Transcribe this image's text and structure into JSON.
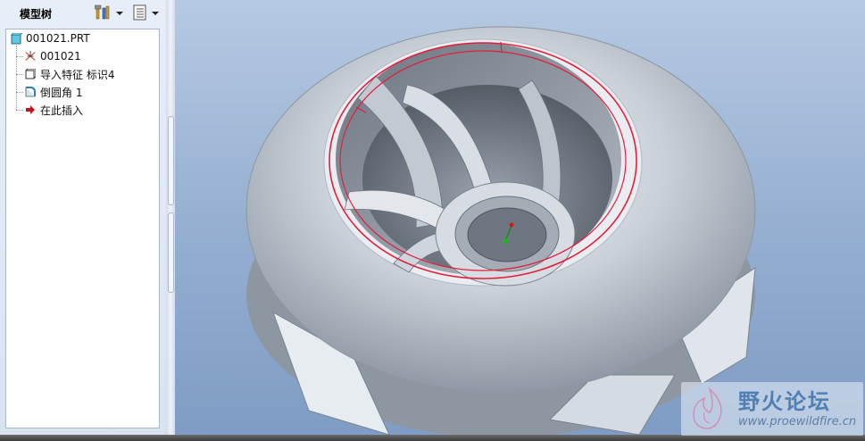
{
  "panel": {
    "title": "模型树",
    "tree": [
      {
        "label": "001021.PRT",
        "icon": "part-icon"
      },
      {
        "label": "001021",
        "icon": "csys-icon"
      },
      {
        "label": "导入特征 标识4",
        "icon": "import-feature-icon"
      },
      {
        "label": "倒圆角 1",
        "icon": "round-icon"
      },
      {
        "label": "在此插入",
        "icon": "insert-here-arrow-icon"
      }
    ]
  },
  "watermark": {
    "title": "野火论坛",
    "url": "www.proewildfire.cn"
  },
  "colors": {
    "background_top": "#b5c9e2",
    "background_bottom": "#7f9cc4",
    "selection_edge": "#e0203a",
    "model_gray": "#b9c2cc"
  }
}
